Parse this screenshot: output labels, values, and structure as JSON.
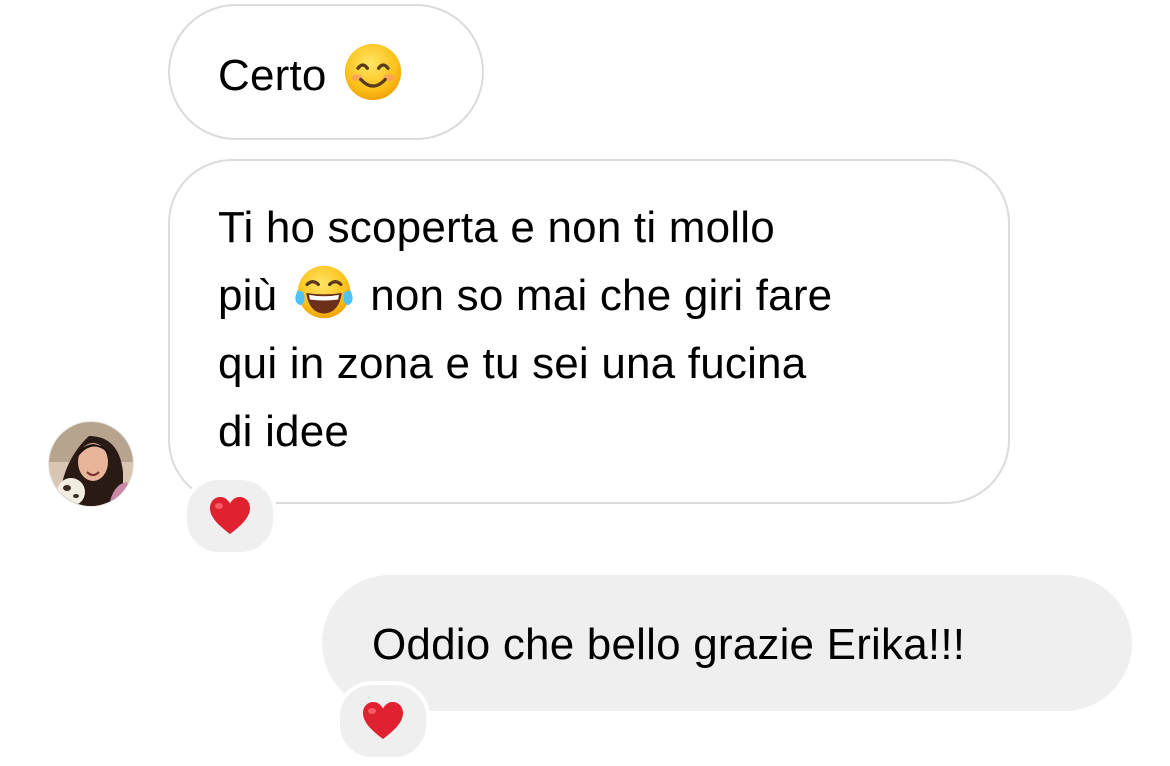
{
  "messages": [
    {
      "direction": "incoming",
      "text_before_emoji": "Certo",
      "emoji": "smiling-face-with-smiling-eyes"
    },
    {
      "direction": "incoming",
      "lines": [
        "Ti ho scoperta e non ti mollo",
        "più",
        "non so mai che giri fare",
        "qui in zona e tu sei una fucina",
        "di idee"
      ],
      "emoji": "face-with-tears-of-joy",
      "reaction": "red-heart"
    },
    {
      "direction": "outgoing",
      "text": "Oddio che bello grazie Erika!!!",
      "reaction": "red-heart"
    }
  ],
  "colors": {
    "incoming_bubble": "#ffffff",
    "incoming_border": "#dbdbdb",
    "outgoing_bubble": "#efefef",
    "reaction_bg": "#efefef",
    "heart": "#e0212f",
    "emoji_yellow": "#fcc21b"
  },
  "avatar": {
    "icon": "user-avatar-photo"
  }
}
